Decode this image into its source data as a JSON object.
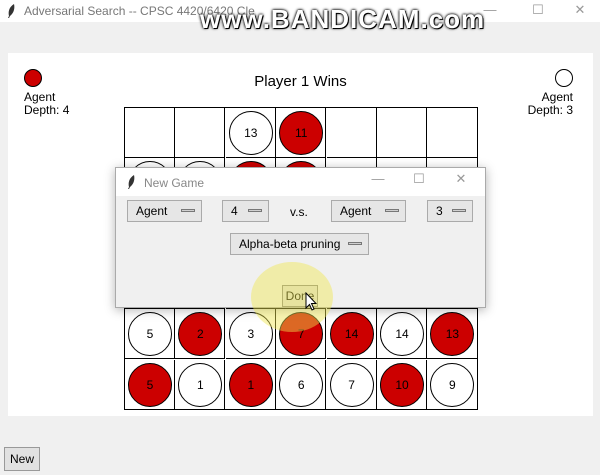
{
  "window": {
    "title": "Adversarial Search -- CPSC 4420/6420 Cle",
    "minimize": "—",
    "maximize": "☐",
    "close": "✕",
    "watermark": "www.BANDICAM.com"
  },
  "status": "Player 1 Wins",
  "player1": {
    "color": "#cc0000",
    "type": "Agent",
    "depth": "Depth: 4"
  },
  "player2": {
    "color": "#ffffff",
    "type": "Agent",
    "depth": "Depth: 3"
  },
  "board": {
    "rows": [
      [
        null,
        null,
        {
          "c": "white",
          "n": "13"
        },
        {
          "c": "red",
          "n": "11"
        },
        null,
        null,
        null
      ],
      [
        {
          "c": "white",
          "n": ""
        },
        {
          "c": "white",
          "n": ""
        },
        {
          "c": "red",
          "n": ""
        },
        {
          "c": "red",
          "n": ""
        },
        null,
        null,
        null
      ],
      [
        null,
        null,
        null,
        null,
        null,
        null,
        null
      ],
      [
        null,
        null,
        null,
        null,
        null,
        null,
        null
      ],
      [
        {
          "c": "white",
          "n": "5"
        },
        {
          "c": "red",
          "n": "2"
        },
        {
          "c": "white",
          "n": "3"
        },
        {
          "c": "red",
          "n": "7"
        },
        {
          "c": "red",
          "n": "14"
        },
        {
          "c": "white",
          "n": "14"
        },
        {
          "c": "red",
          "n": "13"
        }
      ],
      [
        {
          "c": "red",
          "n": "5"
        },
        {
          "c": "white",
          "n": "1"
        },
        {
          "c": "red",
          "n": "1"
        },
        {
          "c": "white",
          "n": "6"
        },
        {
          "c": "white",
          "n": "7"
        },
        {
          "c": "red",
          "n": "10"
        },
        {
          "c": "white",
          "n": "9"
        }
      ]
    ]
  },
  "new_button": "New",
  "dialog": {
    "title": "New Game",
    "minimize": "—",
    "maximize": "☐",
    "close": "✕",
    "p1_type": "Agent",
    "p1_depth": "4",
    "vs": "v.s.",
    "p2_type": "Agent",
    "p2_depth": "3",
    "algorithm": "Alpha-beta pruning",
    "done": "Done"
  }
}
